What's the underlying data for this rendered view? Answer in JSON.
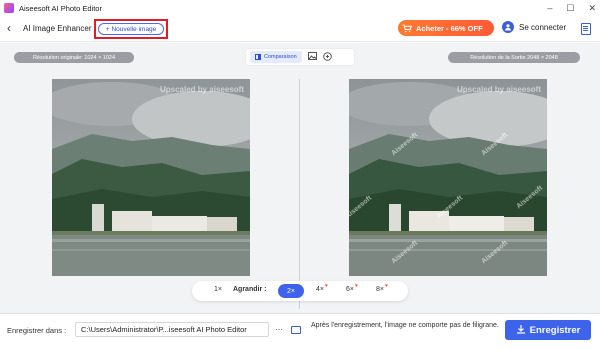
{
  "app": {
    "title": "Aiseesoft AI Photo Editor",
    "controls": {
      "minimize": "–",
      "maximize": "☐",
      "close": "✕"
    }
  },
  "header": {
    "back_icon": "‹",
    "title": "AI Image Enhancer",
    "new_image_label": "Nouvelle image",
    "new_image_icon": "+",
    "buy_label": "Acheter - 66% OFF",
    "login_label": "Se connecter",
    "brand_color": "#3d63ea",
    "highlight_color": "#e31b23",
    "buy_color": "#ff6a33"
  },
  "view": {
    "original_resolution": "Résolution originale: 1024 × 1024",
    "output_resolution": "Résolution de la Sortie 2048 × 2048",
    "compare_label": "Comparaison",
    "modes": [
      "comparison-icon",
      "image-icon",
      "zoom-icon"
    ]
  },
  "watermark": {
    "text": "Upscaled by aiseesoft",
    "tile": "Aiseesoft"
  },
  "scale": {
    "label": "Agrandir :",
    "options": [
      "1×",
      "2×",
      "4×",
      "6×",
      "8×"
    ],
    "selected": "2×"
  },
  "footer": {
    "save_label": "Enregistrer dans :",
    "path": "C:\\Users\\Administrator\\P...iseesoft AI Photo Editor",
    "more_label": "···",
    "note": "Après l'enregistrement, l'image ne comporte pas de filigrane.",
    "save_button": "Enregistrer"
  }
}
